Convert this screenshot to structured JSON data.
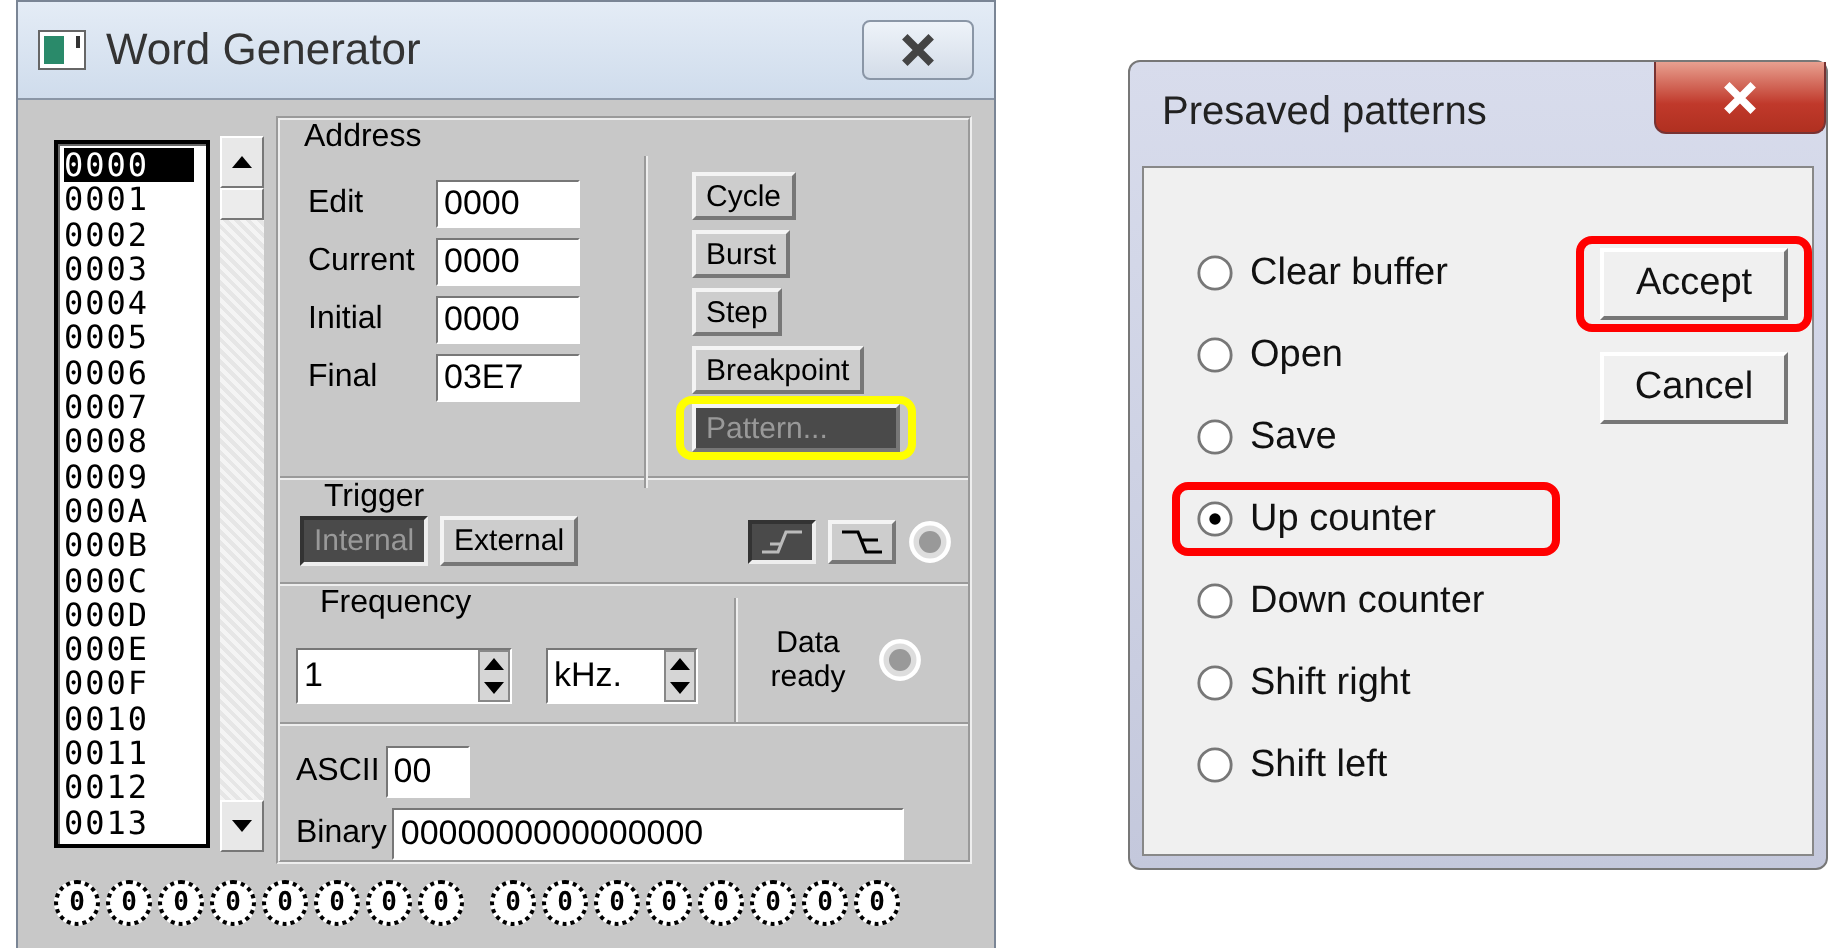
{
  "word_generator": {
    "title": "Word Generator",
    "addresses": [
      {
        "text": "0000",
        "selected": true
      },
      {
        "text": "0001",
        "selected": false
      },
      {
        "text": "0002",
        "selected": false
      },
      {
        "text": "0003",
        "selected": false
      },
      {
        "text": "0004",
        "selected": false
      },
      {
        "text": "0005",
        "selected": false
      },
      {
        "text": "0006",
        "selected": false
      },
      {
        "text": "0007",
        "selected": false
      },
      {
        "text": "0008",
        "selected": false
      },
      {
        "text": "0009",
        "selected": false
      },
      {
        "text": "000A",
        "selected": false
      },
      {
        "text": "000B",
        "selected": false
      },
      {
        "text": "000C",
        "selected": false
      },
      {
        "text": "000D",
        "selected": false
      },
      {
        "text": "000E",
        "selected": false
      },
      {
        "text": "000F",
        "selected": false
      },
      {
        "text": "0010",
        "selected": false
      },
      {
        "text": "0011",
        "selected": false
      },
      {
        "text": "0012",
        "selected": false
      },
      {
        "text": "0013",
        "selected": false
      }
    ],
    "address": {
      "legend": "Address",
      "fields": [
        {
          "label": "Edit",
          "value": "0000"
        },
        {
          "label": "Current",
          "value": "0000"
        },
        {
          "label": "Initial",
          "value": "0000"
        },
        {
          "label": "Final",
          "value": "03E7"
        }
      ]
    },
    "buttons": [
      {
        "label": "Cycle",
        "disabled": false,
        "highlighted": false
      },
      {
        "label": "Burst",
        "disabled": false,
        "highlighted": false
      },
      {
        "label": "Step",
        "disabled": false,
        "highlighted": false
      },
      {
        "label": "Breakpoint",
        "disabled": false,
        "highlighted": false
      },
      {
        "label": "Pattern...",
        "disabled": true,
        "highlighted": true
      }
    ],
    "trigger": {
      "legend": "Trigger",
      "sources": [
        {
          "label": "Internal",
          "selected": true
        },
        {
          "label": "External",
          "selected": false
        }
      ],
      "edges": [
        {
          "kind": "rising",
          "selected": true
        },
        {
          "kind": "falling",
          "selected": false
        }
      ]
    },
    "frequency": {
      "legend": "Frequency",
      "value": "1",
      "unit": "kHz.",
      "data_ready_label": "Data ready"
    },
    "ascii": {
      "label": "ASCII",
      "value": "00"
    },
    "binary": {
      "label": "Binary",
      "value": "0000000000000000"
    },
    "bits": [
      "0",
      "0",
      "0",
      "0",
      "0",
      "0",
      "0",
      "0",
      "0",
      "0",
      "0",
      "0",
      "0",
      "0",
      "0",
      "0"
    ]
  },
  "presaved_patterns": {
    "title": "Presaved patterns",
    "options": [
      {
        "label": "Clear buffer",
        "selected": false,
        "highlighted": false
      },
      {
        "label": "Open",
        "selected": false,
        "highlighted": false
      },
      {
        "label": "Save",
        "selected": false,
        "highlighted": false
      },
      {
        "label": "Up counter",
        "selected": true,
        "highlighted": true
      },
      {
        "label": "Down counter",
        "selected": false,
        "highlighted": false
      },
      {
        "label": "Shift right",
        "selected": false,
        "highlighted": false
      },
      {
        "label": "Shift left",
        "selected": false,
        "highlighted": false
      }
    ],
    "buttons": [
      {
        "label": "Accept",
        "highlighted": true
      },
      {
        "label": "Cancel",
        "highlighted": false
      }
    ]
  }
}
